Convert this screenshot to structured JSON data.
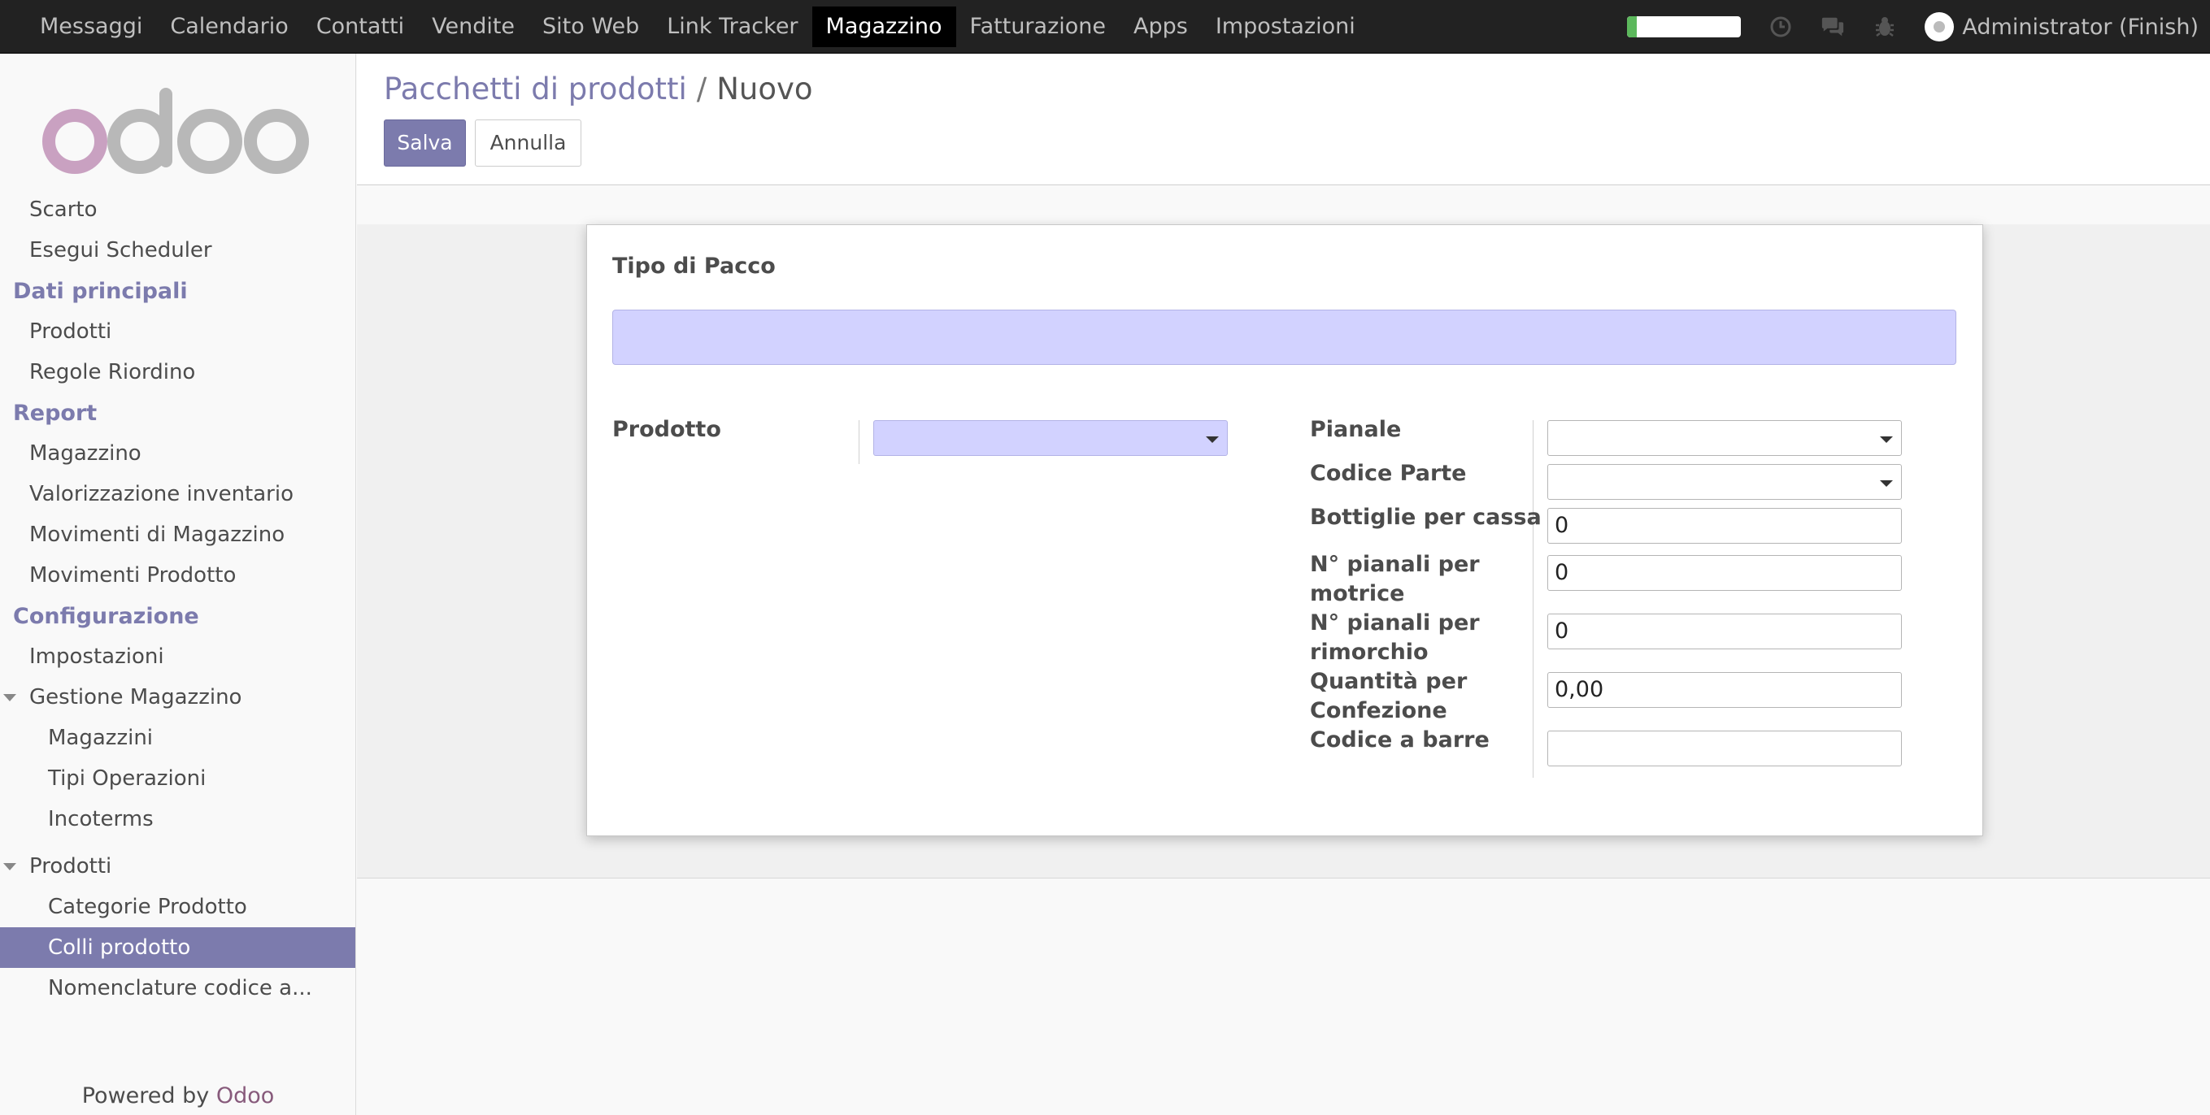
{
  "topbar": {
    "menu": [
      "Messaggi",
      "Calendario",
      "Contatti",
      "Vendite",
      "Sito Web",
      "Link Tracker",
      "Magazzino",
      "Fatturazione",
      "Apps",
      "Impostazioni"
    ],
    "active_menu": "Magazzino",
    "progress_fraction": 0.08,
    "icons": [
      "clock-icon",
      "chat-icon",
      "bug-icon"
    ],
    "user": "Administrator (Finish)"
  },
  "sidebar": {
    "logo_text": "odoo",
    "items": [
      {
        "type": "entry",
        "level": 1,
        "label": "Scarto"
      },
      {
        "type": "entry",
        "level": 1,
        "label": "Esegui Scheduler"
      },
      {
        "type": "section",
        "label": "Dati principali"
      },
      {
        "type": "entry",
        "level": 1,
        "label": "Prodotti"
      },
      {
        "type": "entry",
        "level": 1,
        "label": "Regole Riordino"
      },
      {
        "type": "section",
        "label": "Report"
      },
      {
        "type": "entry",
        "level": 1,
        "label": "Magazzino"
      },
      {
        "type": "entry",
        "level": 1,
        "label": "Valorizzazione inventario"
      },
      {
        "type": "entry",
        "level": 1,
        "label": "Movimenti di Magazzino"
      },
      {
        "type": "entry",
        "level": 1,
        "label": "Movimenti Prodotto"
      },
      {
        "type": "section",
        "label": "Configurazione"
      },
      {
        "type": "entry",
        "level": 1,
        "label": "Impostazioni"
      },
      {
        "type": "group",
        "level": 1,
        "label": "Gestione Magazzino"
      },
      {
        "type": "entry",
        "level": 2,
        "label": "Magazzini"
      },
      {
        "type": "entry",
        "level": 2,
        "label": "Tipi Operazioni"
      },
      {
        "type": "entry",
        "level": 2,
        "label": "Incoterms"
      },
      {
        "type": "group",
        "level": 1,
        "label": "Prodotti"
      },
      {
        "type": "entry",
        "level": 2,
        "label": "Categorie Prodotto"
      },
      {
        "type": "entry",
        "level": 2,
        "label": "Colli prodotto",
        "active": true
      },
      {
        "type": "entry",
        "level": 2,
        "label": "Nomenclature codice a..."
      }
    ],
    "powered_prefix": "Powered by",
    "powered_brand": "Odoo"
  },
  "control": {
    "breadcrumb_parent": "Pacchetti di prodotti",
    "breadcrumb_sep": "/",
    "breadcrumb_current": "Nuovo",
    "save_label": "Salva",
    "cancel_label": "Annulla"
  },
  "form": {
    "title": "Tipo di Pacco",
    "name_value": "",
    "prodotto_label": "Prodotto",
    "prodotto_value": "",
    "pianale_label": "Pianale",
    "pianale_value": "",
    "codice_parte_label": "Codice Parte",
    "codice_parte_value": "",
    "bottiglie_label": "Bottiglie per cassa",
    "bottiglie_value": "0",
    "pianali_motrice_label": "N° pianali per motrice",
    "pianali_motrice_value": "0",
    "pianali_rimorchio_label": "N° pianali per rimorchio",
    "pianali_rimorchio_value": "0",
    "quantita_label": "Quantità per Confezione",
    "quantita_value": "0,00",
    "barcode_label": "Codice a barre",
    "barcode_value": ""
  },
  "colors": {
    "accent": "#7c7bad",
    "brand": "#875a7b",
    "required_field": "#d2d2ff",
    "topbar": "#222222"
  }
}
